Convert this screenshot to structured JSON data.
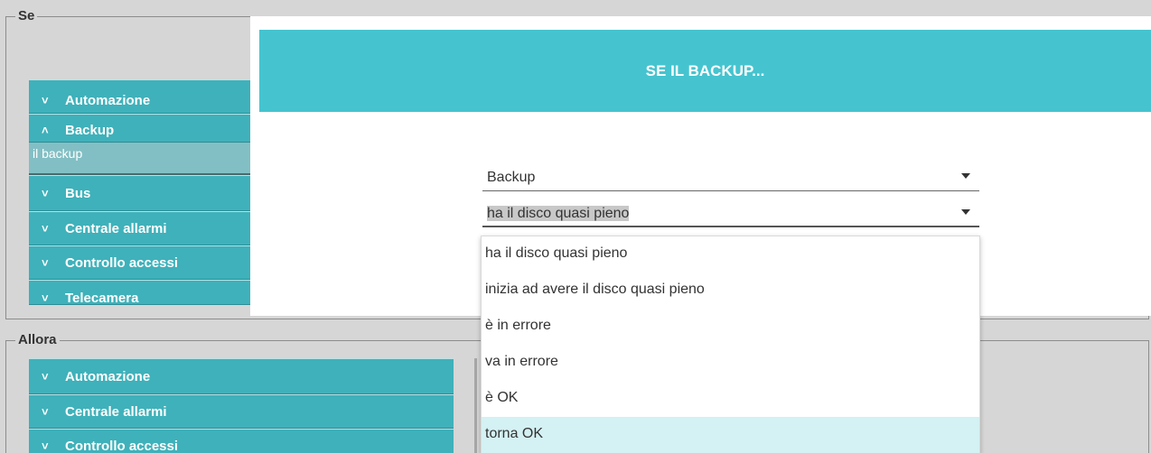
{
  "se_section": {
    "legend": "Se",
    "categories": [
      {
        "label": "Automazione",
        "chevron": "˅"
      },
      {
        "label": "Backup",
        "chevron": "˄"
      },
      {
        "label": "Bus",
        "chevron": "˅"
      },
      {
        "label": "Centrale allarmi",
        "chevron": "˅"
      },
      {
        "label": "Controllo accessi",
        "chevron": "˅"
      },
      {
        "label": "Telecamera",
        "chevron": "˅"
      }
    ],
    "selected_subitem": "il backup"
  },
  "allora_section": {
    "legend": "Allora",
    "categories": [
      {
        "label": "Automazione",
        "chevron": "˅"
      },
      {
        "label": "Centrale allarmi",
        "chevron": "˅"
      },
      {
        "label": "Controllo accessi",
        "chevron": "˅"
      }
    ]
  },
  "modal": {
    "title": "SE IL BACKUP...",
    "subject_select": {
      "value": "Backup"
    },
    "condition_select": {
      "value": "ha il disco quasi pieno"
    },
    "options": [
      "ha il disco quasi pieno",
      "inizia ad avere il disco quasi pieno",
      "è in errore",
      "va in errore",
      "è OK",
      "torna OK"
    ],
    "highlighted_option": "torna OK"
  },
  "colors": {
    "accent": "#45c4cf",
    "accordion": "#3fb1ba",
    "subitem": "#82bfc4",
    "highlight": "#d4f1f3"
  }
}
